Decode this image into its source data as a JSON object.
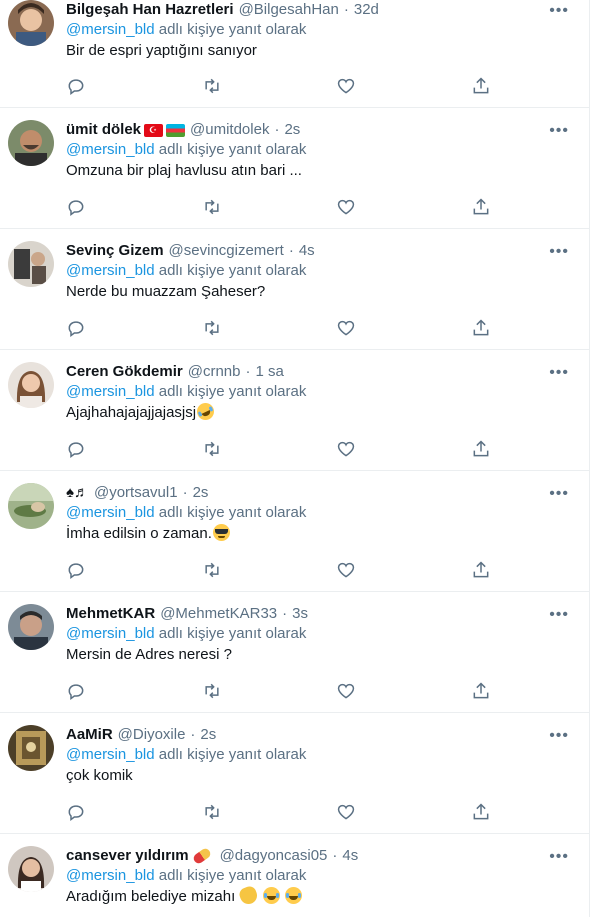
{
  "tweets": [
    {
      "name": "Bilgeşah Han Hazretleri",
      "handle": "@BilgesahHan",
      "time": "32d",
      "reply_prefix": "@mersin_bld",
      "reply_suffix": " adlı kişiye yanıt olarak",
      "text": "Bir de espri yaptığını sanıyor"
    },
    {
      "name": "ümit dölek",
      "handle": "@umitdolek",
      "time": "2s",
      "reply_prefix": "@mersin_bld",
      "reply_suffix": " adlı kişiye yanıt olarak",
      "text": "Omzuna bir plaj havlusu atın bari ..."
    },
    {
      "name": "Sevinç Gizem",
      "handle": "@sevincgizemert",
      "time": "4s",
      "reply_prefix": "@mersin_bld",
      "reply_suffix": " adlı kişiye yanıt olarak",
      "text": "Nerde bu muazzam Şaheser?"
    },
    {
      "name": "Ceren Gökdemir",
      "handle": "@crnnb",
      "time": "1 sa",
      "reply_prefix": "@mersin_bld",
      "reply_suffix": " adlı kişiye yanıt olarak",
      "text": "Ajajhahajajajjajasjsj"
    },
    {
      "name": "♠♬",
      "handle": "@yortsavul1",
      "time": "2s",
      "reply_prefix": "@mersin_bld",
      "reply_suffix": " adlı kişiye yanıt olarak",
      "text": "İmha edilsin o zaman."
    },
    {
      "name": "MehmetKAR",
      "handle": "@MehmetKAR33",
      "time": "3s",
      "reply_prefix": "@mersin_bld",
      "reply_suffix": " adlı kişiye yanıt olarak",
      "text": "Mersin de Adres neresi ?"
    },
    {
      "name": "AaMiR",
      "handle": "@Diyoxile",
      "time": "2s",
      "reply_prefix": "@mersin_bld",
      "reply_suffix": " adlı kişiye yanıt olarak",
      "text": "çok komik"
    },
    {
      "name": "cansever yıldırım",
      "handle": "@dagyoncasi05",
      "time": "4s",
      "reply_prefix": "@mersin_bld",
      "reply_suffix": " adlı kişiye yanıt olarak",
      "text": "Aradığım belediye mizahı "
    }
  ],
  "ui": {
    "dot": "·",
    "more_glyph": "•••",
    "icons": [
      "reply-icon",
      "retweet-icon",
      "like-icon",
      "share-icon",
      "more-icon"
    ],
    "colors": {
      "text": "#0f1419",
      "secondary": "#5b7083",
      "mention": "#1b95e0",
      "divider": "#ebeef0"
    }
  }
}
